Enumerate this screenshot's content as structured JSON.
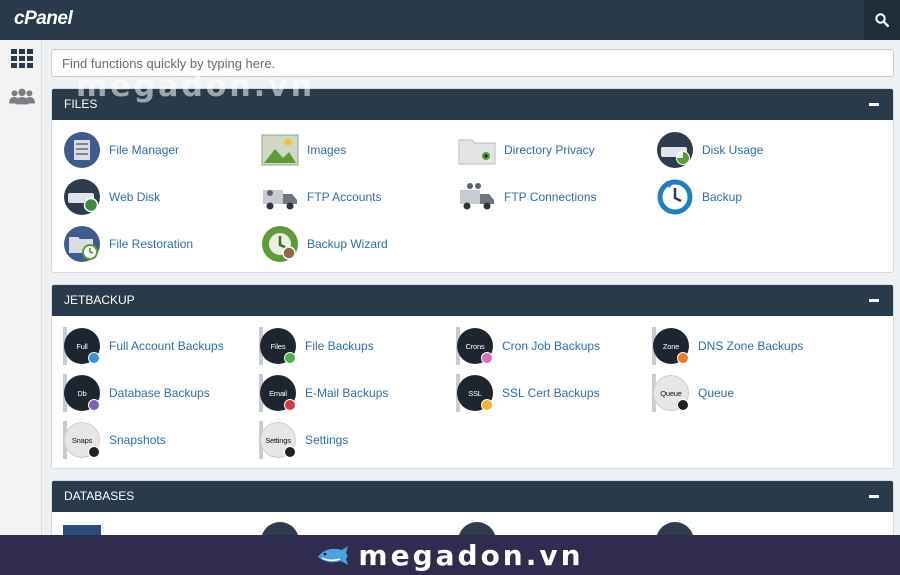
{
  "app": {
    "logo_text": "cPanel"
  },
  "search": {
    "placeholder": "Find functions quickly by typing here."
  },
  "sections": [
    {
      "title": "FILES",
      "items": [
        "File Manager",
        "Images",
        "Directory Privacy",
        "Disk Usage",
        "Web Disk",
        "FTP Accounts",
        "FTP Connections",
        "Backup",
        "File Restoration",
        "Backup Wizard"
      ]
    },
    {
      "title": "JETBACKUP",
      "items": [
        "Full Account Backups",
        "File Backups",
        "Cron Job Backups",
        "DNS Zone Backups",
        "Database Backups",
        "E-Mail Backups",
        "SSL Cert Backups",
        "Queue",
        "Snapshots",
        "Settings"
      ],
      "icon_text": [
        "Full",
        "Files",
        "Crons",
        "Zone",
        "Db",
        "Email",
        "SSL",
        "Queue",
        "Snaps",
        "Settings"
      ]
    },
    {
      "title": "DATABASES"
    }
  ],
  "watermark": {
    "text": "megadon.vn",
    "top_text": "megadon.vn"
  },
  "icons": {
    "top_search": "search-icon",
    "sidebar": [
      "grid-icon",
      "users-icon"
    ]
  },
  "colors": {
    "header": "#293a4a",
    "link": "#2a6fb0",
    "bottom_bar": "#2f2c50"
  }
}
